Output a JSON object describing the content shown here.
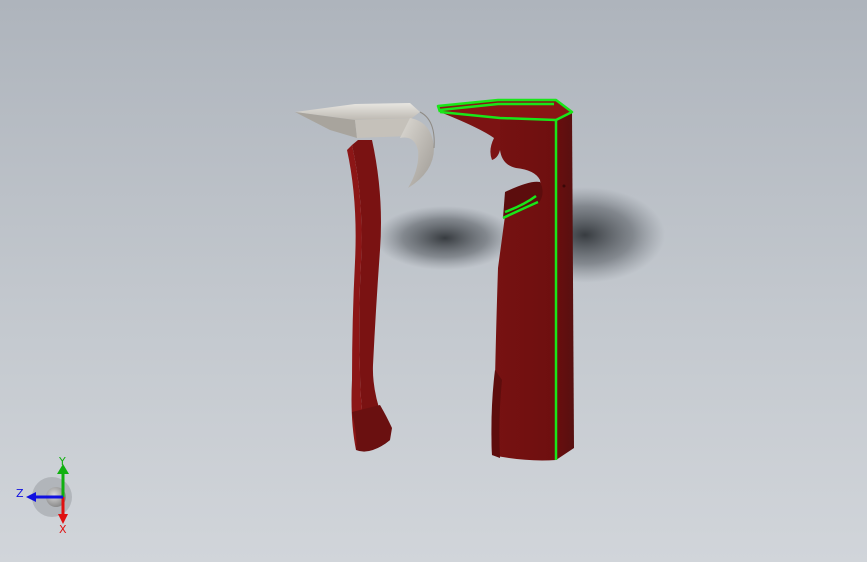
{
  "viewport": {
    "background_top": "#aeb4bc",
    "background_bottom": "#d1d5da"
  },
  "models": [
    {
      "name": "hammer-part",
      "head_color": "#c8c4bc",
      "handle_color": "#7a1212",
      "handle_shadow_color": "#1a0505"
    },
    {
      "name": "handle-sleeve-part",
      "body_color": "#7a1212",
      "highlight_edge_color": "#19e619"
    }
  ],
  "triad": {
    "x_label": "X",
    "y_label": "Y",
    "z_label": "Z",
    "x_color": "#e01010",
    "y_color": "#10b010",
    "z_color": "#1010e0"
  }
}
